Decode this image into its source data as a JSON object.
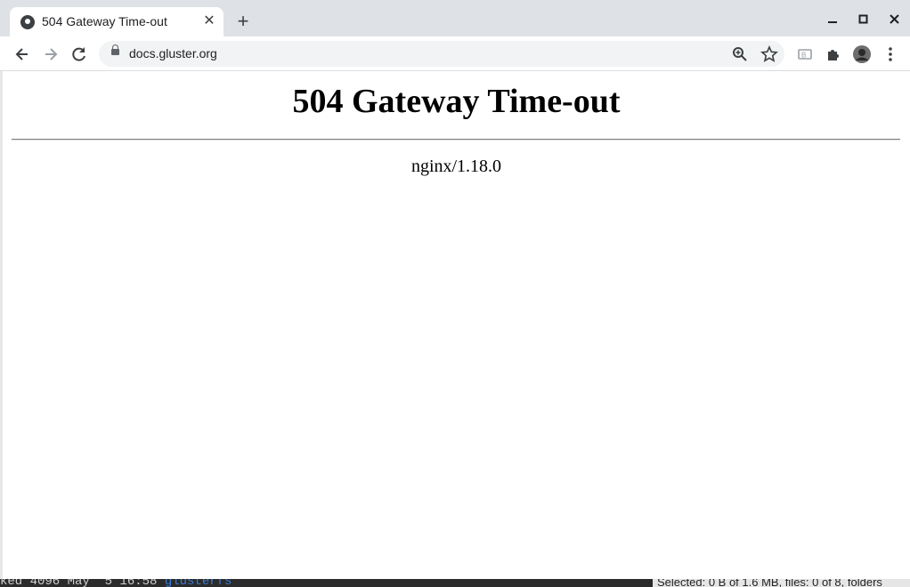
{
  "browser": {
    "tab": {
      "title": "504 Gateway Time-out",
      "close_glyph": "✕"
    },
    "new_tab_glyph": "+",
    "window_controls": {
      "minimize": "–",
      "maximize": "□",
      "close": "✕"
    },
    "nav": {
      "back": "←",
      "forward": "→",
      "reload": "⟳"
    },
    "omnibox": {
      "url": "docs.gluster.org"
    },
    "icons": [
      "zoom-icon",
      "bookmark-star-icon",
      "cast-icon",
      "extensions-icon",
      "profile-avatar",
      "menu-icon"
    ]
  },
  "page": {
    "heading": "504 Gateway Time-out",
    "server": "nginx/1.18.0"
  },
  "taskbar": {
    "terminal_prefix": "ked 4096 May  5 16:58 ",
    "terminal_dir": "glusterfs",
    "status": "Selected: 0 B of 1.6 MB, files: 0 of 8, folders"
  }
}
